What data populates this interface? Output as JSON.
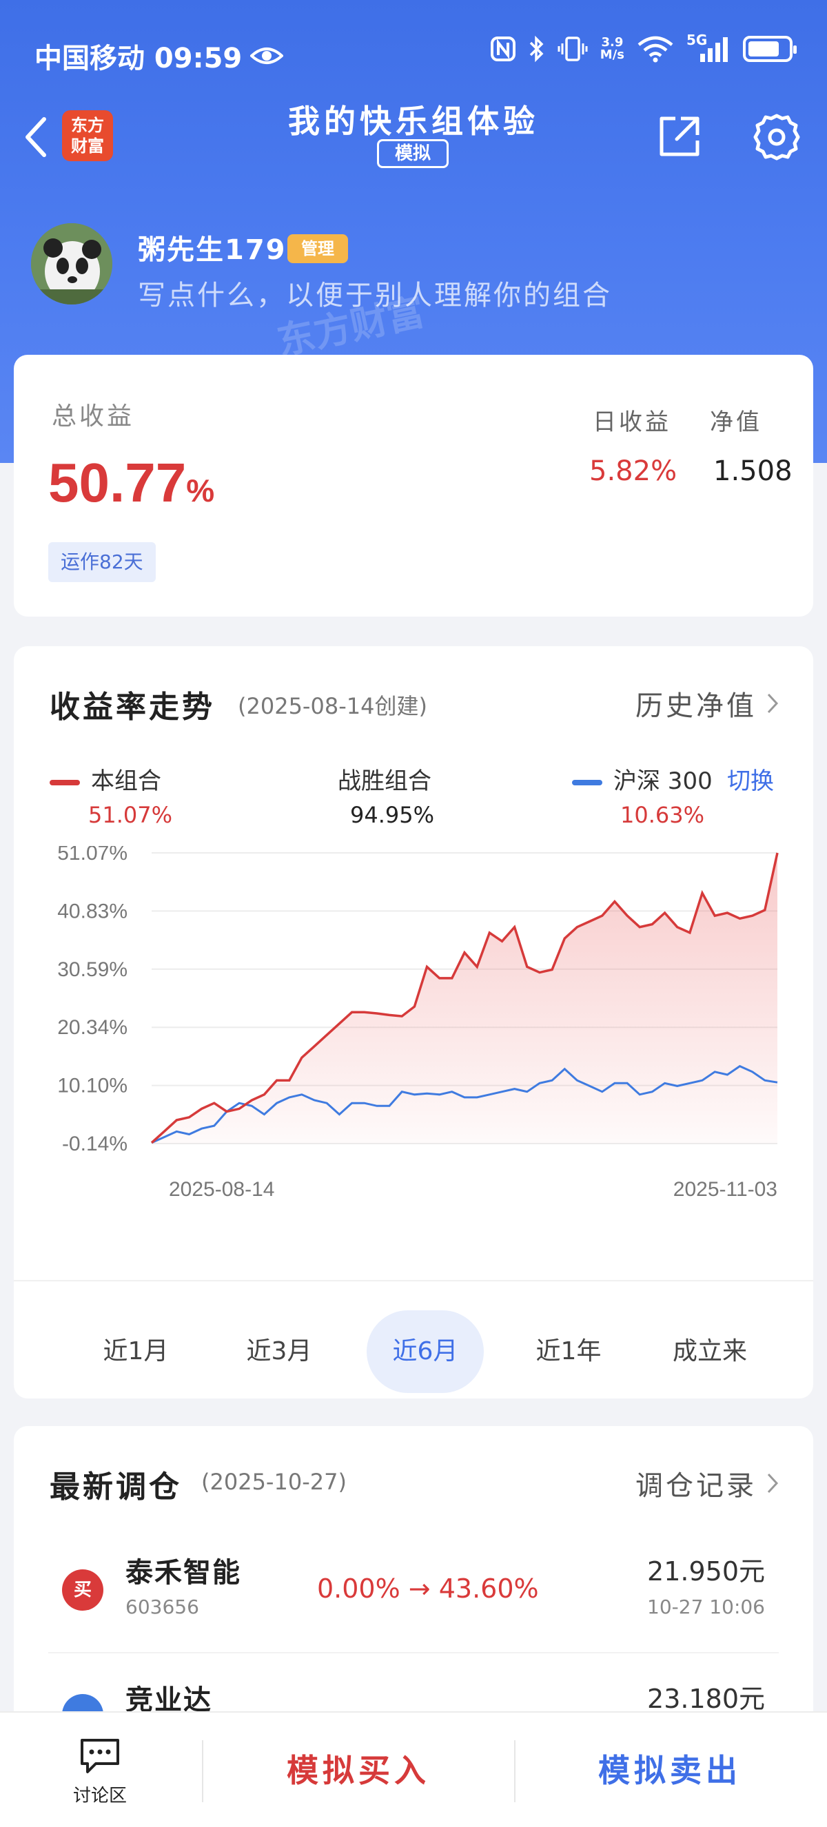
{
  "status_bar": {
    "carrier_time": "中国移动 09:59",
    "net_speed_value": "3.9",
    "net_speed_unit": "M/s",
    "network": "5G",
    "battery_level": 0.78
  },
  "nav": {
    "logo_line1": "东方",
    "logo_line2": "财富",
    "title": "我的快乐组体验",
    "mode_badge": "模拟"
  },
  "profile": {
    "username": "粥先生179",
    "role_badge": "管理",
    "bio": "写点什么，以便于别人理解你的组合"
  },
  "summary": {
    "total_label": "总收益",
    "total_value": "50.77",
    "total_unit": "%",
    "run_days": "运作82天",
    "daily_label": "日收益",
    "daily_value": "5.82%",
    "nav_label": "净值",
    "nav_value": "1.508"
  },
  "trend": {
    "title": "收益率走势",
    "created": "(2025-08-14创建)",
    "history_link": "历史净值",
    "legend": {
      "portfolio_name": "本组合",
      "portfolio_value": "51.07%",
      "beat_label": "战胜组合",
      "beat_value": "94.95%",
      "index_name": "沪深 300",
      "index_value": "10.63%",
      "switch": "切换"
    },
    "periods": [
      "近1月",
      "近3月",
      "近6月",
      "近1年",
      "成立来"
    ],
    "active_period": "近6月"
  },
  "chart_data": {
    "type": "area",
    "ylim": [
      -0.14,
      51.07
    ],
    "yticks": [
      "51.07%",
      "40.83%",
      "30.59%",
      "20.34%",
      "10.10%",
      "-0.14%"
    ],
    "x_start": "2025-08-14",
    "x_end": "2025-11-03",
    "series": [
      {
        "name": "本组合",
        "color": "#d63a3a",
        "values": [
          0,
          2,
          4,
          4.5,
          6,
          7,
          5.5,
          6,
          7.5,
          8.5,
          11,
          11,
          15,
          17,
          19,
          21,
          23,
          23,
          22.8,
          22.5,
          22.3,
          24,
          31,
          29,
          29,
          33.5,
          31,
          37,
          35.5,
          38,
          31,
          30,
          30.5,
          36,
          38,
          39,
          40,
          42.5,
          40,
          38,
          38.5,
          40.5,
          38,
          37,
          44,
          40,
          40.5,
          39.5,
          40,
          41,
          51.07
        ]
      },
      {
        "name": "沪深 300",
        "color": "#3f7be0",
        "values": [
          0,
          1,
          2,
          1.5,
          2.5,
          3,
          5.5,
          7,
          6.5,
          5,
          7,
          8,
          8.5,
          7.5,
          7,
          5,
          7,
          7,
          6.5,
          6.5,
          9,
          8.5,
          8.7,
          8.5,
          9,
          8,
          8,
          8.5,
          9,
          9.5,
          9,
          10.5,
          11,
          13,
          11,
          10,
          9,
          10.5,
          10.5,
          8.5,
          9,
          10.5,
          10,
          10.5,
          11,
          12.5,
          12,
          13.5,
          12.5,
          11,
          10.63
        ]
      }
    ]
  },
  "rebalance": {
    "title": "最新调仓",
    "date": "(2025-10-27)",
    "history_link": "调仓记录",
    "items": [
      {
        "action": "买",
        "name": "泰禾智能",
        "code": "603656",
        "change": "0.00% → 43.60%",
        "price": "21.950元",
        "time": "10-27 10:06"
      },
      {
        "name": "竞业达",
        "price": "23.180元"
      }
    ]
  },
  "bottom_bar": {
    "discuss_label": "讨论区",
    "buy_label": "模拟买入",
    "sell_label": "模拟卖出"
  }
}
